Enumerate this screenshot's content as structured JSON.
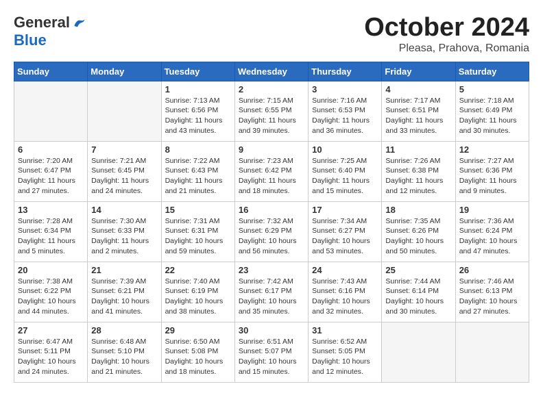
{
  "header": {
    "logo_general": "General",
    "logo_blue": "Blue",
    "month_title": "October 2024",
    "subtitle": "Pleasa, Prahova, Romania"
  },
  "days_of_week": [
    "Sunday",
    "Monday",
    "Tuesday",
    "Wednesday",
    "Thursday",
    "Friday",
    "Saturday"
  ],
  "weeks": [
    [
      {
        "day": "",
        "empty": true
      },
      {
        "day": "",
        "empty": true
      },
      {
        "day": "1",
        "sunrise": "Sunrise: 7:13 AM",
        "sunset": "Sunset: 6:56 PM",
        "daylight": "Daylight: 11 hours and 43 minutes."
      },
      {
        "day": "2",
        "sunrise": "Sunrise: 7:15 AM",
        "sunset": "Sunset: 6:55 PM",
        "daylight": "Daylight: 11 hours and 39 minutes."
      },
      {
        "day": "3",
        "sunrise": "Sunrise: 7:16 AM",
        "sunset": "Sunset: 6:53 PM",
        "daylight": "Daylight: 11 hours and 36 minutes."
      },
      {
        "day": "4",
        "sunrise": "Sunrise: 7:17 AM",
        "sunset": "Sunset: 6:51 PM",
        "daylight": "Daylight: 11 hours and 33 minutes."
      },
      {
        "day": "5",
        "sunrise": "Sunrise: 7:18 AM",
        "sunset": "Sunset: 6:49 PM",
        "daylight": "Daylight: 11 hours and 30 minutes."
      }
    ],
    [
      {
        "day": "6",
        "sunrise": "Sunrise: 7:20 AM",
        "sunset": "Sunset: 6:47 PM",
        "daylight": "Daylight: 11 hours and 27 minutes."
      },
      {
        "day": "7",
        "sunrise": "Sunrise: 7:21 AM",
        "sunset": "Sunset: 6:45 PM",
        "daylight": "Daylight: 11 hours and 24 minutes."
      },
      {
        "day": "8",
        "sunrise": "Sunrise: 7:22 AM",
        "sunset": "Sunset: 6:43 PM",
        "daylight": "Daylight: 11 hours and 21 minutes."
      },
      {
        "day": "9",
        "sunrise": "Sunrise: 7:23 AM",
        "sunset": "Sunset: 6:42 PM",
        "daylight": "Daylight: 11 hours and 18 minutes."
      },
      {
        "day": "10",
        "sunrise": "Sunrise: 7:25 AM",
        "sunset": "Sunset: 6:40 PM",
        "daylight": "Daylight: 11 hours and 15 minutes."
      },
      {
        "day": "11",
        "sunrise": "Sunrise: 7:26 AM",
        "sunset": "Sunset: 6:38 PM",
        "daylight": "Daylight: 11 hours and 12 minutes."
      },
      {
        "day": "12",
        "sunrise": "Sunrise: 7:27 AM",
        "sunset": "Sunset: 6:36 PM",
        "daylight": "Daylight: 11 hours and 9 minutes."
      }
    ],
    [
      {
        "day": "13",
        "sunrise": "Sunrise: 7:28 AM",
        "sunset": "Sunset: 6:34 PM",
        "daylight": "Daylight: 11 hours and 5 minutes."
      },
      {
        "day": "14",
        "sunrise": "Sunrise: 7:30 AM",
        "sunset": "Sunset: 6:33 PM",
        "daylight": "Daylight: 11 hours and 2 minutes."
      },
      {
        "day": "15",
        "sunrise": "Sunrise: 7:31 AM",
        "sunset": "Sunset: 6:31 PM",
        "daylight": "Daylight: 10 hours and 59 minutes."
      },
      {
        "day": "16",
        "sunrise": "Sunrise: 7:32 AM",
        "sunset": "Sunset: 6:29 PM",
        "daylight": "Daylight: 10 hours and 56 minutes."
      },
      {
        "day": "17",
        "sunrise": "Sunrise: 7:34 AM",
        "sunset": "Sunset: 6:27 PM",
        "daylight": "Daylight: 10 hours and 53 minutes."
      },
      {
        "day": "18",
        "sunrise": "Sunrise: 7:35 AM",
        "sunset": "Sunset: 6:26 PM",
        "daylight": "Daylight: 10 hours and 50 minutes."
      },
      {
        "day": "19",
        "sunrise": "Sunrise: 7:36 AM",
        "sunset": "Sunset: 6:24 PM",
        "daylight": "Daylight: 10 hours and 47 minutes."
      }
    ],
    [
      {
        "day": "20",
        "sunrise": "Sunrise: 7:38 AM",
        "sunset": "Sunset: 6:22 PM",
        "daylight": "Daylight: 10 hours and 44 minutes."
      },
      {
        "day": "21",
        "sunrise": "Sunrise: 7:39 AM",
        "sunset": "Sunset: 6:21 PM",
        "daylight": "Daylight: 10 hours and 41 minutes."
      },
      {
        "day": "22",
        "sunrise": "Sunrise: 7:40 AM",
        "sunset": "Sunset: 6:19 PM",
        "daylight": "Daylight: 10 hours and 38 minutes."
      },
      {
        "day": "23",
        "sunrise": "Sunrise: 7:42 AM",
        "sunset": "Sunset: 6:17 PM",
        "daylight": "Daylight: 10 hours and 35 minutes."
      },
      {
        "day": "24",
        "sunrise": "Sunrise: 7:43 AM",
        "sunset": "Sunset: 6:16 PM",
        "daylight": "Daylight: 10 hours and 32 minutes."
      },
      {
        "day": "25",
        "sunrise": "Sunrise: 7:44 AM",
        "sunset": "Sunset: 6:14 PM",
        "daylight": "Daylight: 10 hours and 30 minutes."
      },
      {
        "day": "26",
        "sunrise": "Sunrise: 7:46 AM",
        "sunset": "Sunset: 6:13 PM",
        "daylight": "Daylight: 10 hours and 27 minutes."
      }
    ],
    [
      {
        "day": "27",
        "sunrise": "Sunrise: 6:47 AM",
        "sunset": "Sunset: 5:11 PM",
        "daylight": "Daylight: 10 hours and 24 minutes."
      },
      {
        "day": "28",
        "sunrise": "Sunrise: 6:48 AM",
        "sunset": "Sunset: 5:10 PM",
        "daylight": "Daylight: 10 hours and 21 minutes."
      },
      {
        "day": "29",
        "sunrise": "Sunrise: 6:50 AM",
        "sunset": "Sunset: 5:08 PM",
        "daylight": "Daylight: 10 hours and 18 minutes."
      },
      {
        "day": "30",
        "sunrise": "Sunrise: 6:51 AM",
        "sunset": "Sunset: 5:07 PM",
        "daylight": "Daylight: 10 hours and 15 minutes."
      },
      {
        "day": "31",
        "sunrise": "Sunrise: 6:52 AM",
        "sunset": "Sunset: 5:05 PM",
        "daylight": "Daylight: 10 hours and 12 minutes."
      },
      {
        "day": "",
        "empty": true
      },
      {
        "day": "",
        "empty": true
      }
    ]
  ]
}
